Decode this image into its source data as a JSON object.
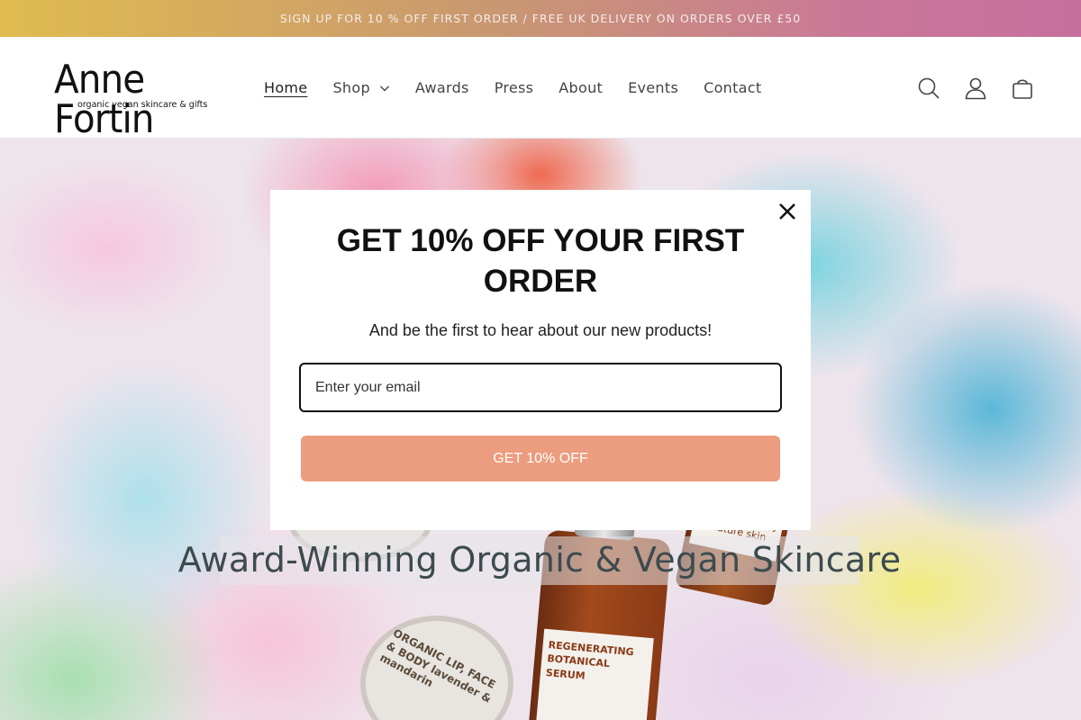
{
  "announcement": {
    "text": "SIGN UP FOR 10 % OFF FIRST ORDER / FREE UK DELIVERY ON ORDERS OVER £50"
  },
  "logo": {
    "name": "Anne Fortin",
    "tagline": "organic vegan skincare & gifts"
  },
  "nav": {
    "items": [
      {
        "label": "Home",
        "active": true
      },
      {
        "label": "Shop",
        "has_dropdown": true
      },
      {
        "label": "Awards"
      },
      {
        "label": "Press"
      },
      {
        "label": "About"
      },
      {
        "label": "Events"
      },
      {
        "label": "Contact"
      }
    ]
  },
  "header_icons": [
    "search-icon",
    "account-icon",
    "cart-icon"
  ],
  "hero": {
    "title": "Award-Winning Organic & Vegan Skincare",
    "product_labels": {
      "bottle": "REGENERATING BOTANICAL SERUM",
      "jar": "eyes + neck dry + mature skin",
      "tin": "ORGANIC LIP, FACE & BODY lavender & mandarin"
    }
  },
  "popup": {
    "heading": "GET 10% OFF YOUR FIRST ORDER",
    "subheading": "And be the first to hear about our new products!",
    "email_placeholder": "Enter your email",
    "button_label": "GET 10% OFF",
    "button_color": "#ec9c7f"
  }
}
